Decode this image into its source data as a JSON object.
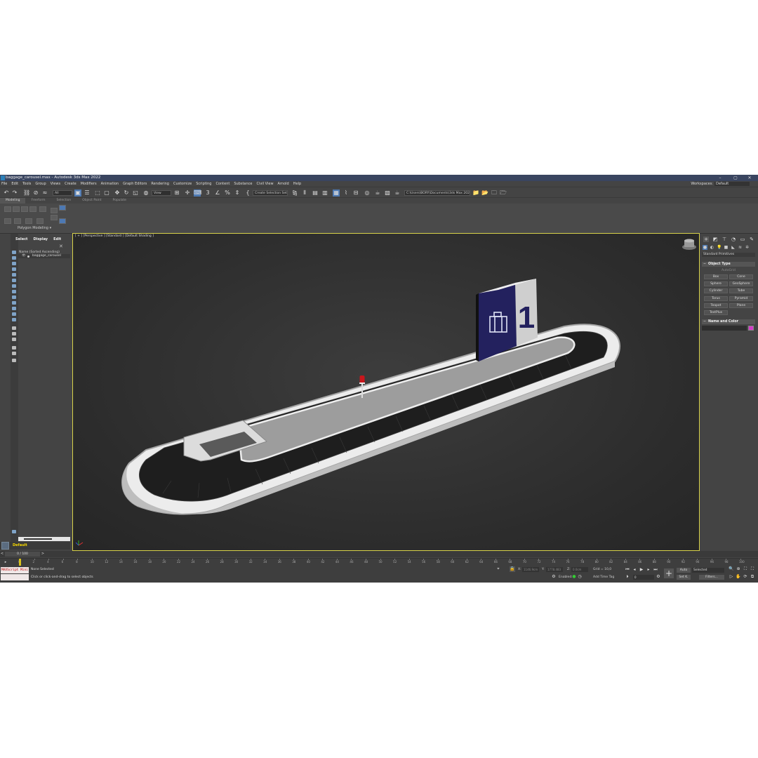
{
  "window": {
    "title": "baggage_carousel.max - Autodesk 3ds Max 2022",
    "minimize": "–",
    "maximize": "▢",
    "close": "✕"
  },
  "menu": [
    "File",
    "Edit",
    "Tools",
    "Group",
    "Views",
    "Create",
    "Modifiers",
    "Animation",
    "Graph Editors",
    "Rendering",
    "Customize",
    "Scripting",
    "Content",
    "Substance",
    "Civil View",
    "Arnold",
    "Help"
  ],
  "workspace": {
    "label": "Workspaces:",
    "value": "Default"
  },
  "toolbar": {
    "selection_filter": "All",
    "ref_coord": "View",
    "named_selection": "Create Selection Set",
    "path": "C:\\Users\\BORY\\Documents\\3ds Max 2022"
  },
  "ribbon": {
    "tabs": [
      "Modeling",
      "Freeform",
      "Selection",
      "Object Paint",
      "Populate"
    ],
    "panel_label": "Polygon Modeling"
  },
  "scene_explorer": {
    "tabs": [
      "Select",
      "Display",
      "Edit"
    ],
    "close": "✕",
    "header": "Name (Sorted Ascending)",
    "eye": "👁",
    "items": [
      "baggage_carousel"
    ],
    "layer": "Default"
  },
  "viewport": {
    "label": "[ + ] [Perspective ] [Standard ] [Default Shading ]"
  },
  "command_panel": {
    "dropdown": "Standard Primitives",
    "object_type": "Object Type",
    "autogrid": "AutoGrid",
    "primitives": [
      "Box",
      "Cone",
      "Sphere",
      "GeoSphere",
      "Cylinder",
      "Tube",
      "Torus",
      "Pyramid",
      "Teapot",
      "Plane",
      "TextPlus"
    ],
    "name_and_color": "Name and Color",
    "swatch_color": "#d43ac8"
  },
  "timeline": {
    "frame": "0 / 100",
    "ticks": [
      "0",
      "2",
      "4",
      "6",
      "8",
      "10",
      "12",
      "14",
      "16",
      "18",
      "20",
      "22",
      "24",
      "26",
      "28",
      "30",
      "32",
      "34",
      "36",
      "38",
      "40",
      "42",
      "44",
      "46",
      "48",
      "50",
      "52",
      "54",
      "56",
      "58",
      "60",
      "62",
      "64",
      "66",
      "68",
      "70",
      "72",
      "74",
      "76",
      "78",
      "80",
      "82",
      "84",
      "86",
      "88",
      "90",
      "92",
      "94",
      "96",
      "98",
      "100"
    ]
  },
  "status": {
    "maxscript": "MAXScript Mini",
    "selection": "None Selected",
    "prompt": "Click or click-and-drag to select objects",
    "x_label": "X:",
    "y_label": "Y:",
    "z_label": "Z:",
    "x_val": "1146.9cm",
    "y_val": "1778.483",
    "z_val": "0.0cm",
    "grid": "Grid = 10,0",
    "enabled": "Enabled:",
    "add_time_tag": "Add Time Tag",
    "auto": "Auto",
    "set_key": "Set K.",
    "selected": "Selected",
    "filters": "Filters...",
    "frame_val": "0"
  },
  "model": {
    "sign_number": "1",
    "base_color": "#d9d9d9",
    "belt_color": "#1e1e1e",
    "sign_color": "#23215e"
  }
}
